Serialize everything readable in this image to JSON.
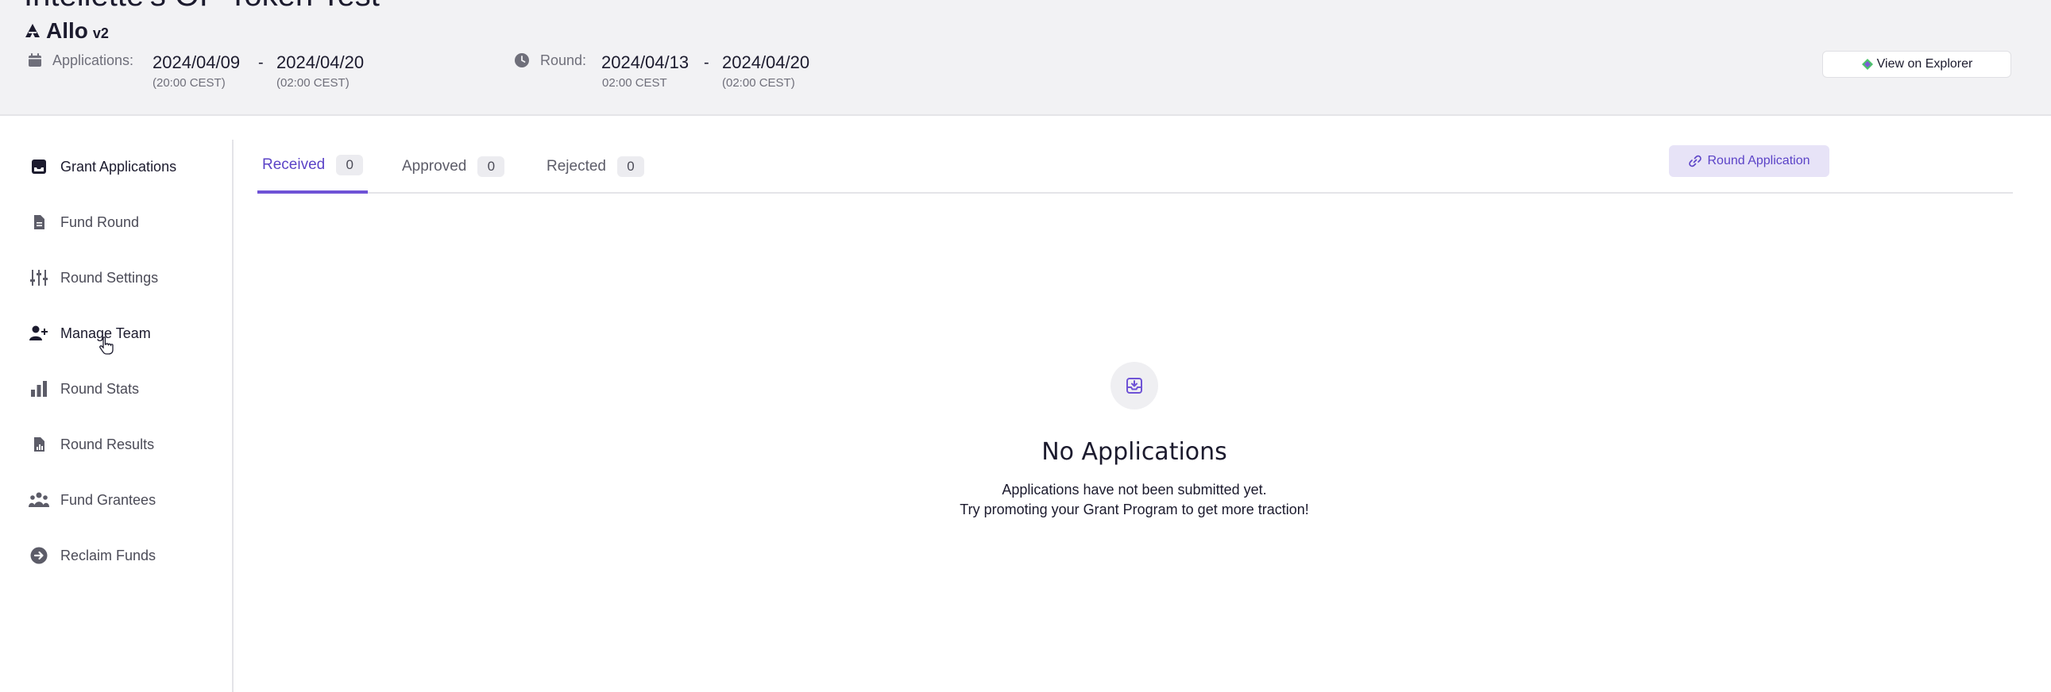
{
  "header": {
    "round_title": "Intellette's OP Token Test",
    "brand": {
      "name": "Allo",
      "version": "v2"
    },
    "applications": {
      "label": "Applications:",
      "start": "2024/04/09",
      "start_sub": "(20:00 CEST)",
      "separator": "-",
      "end": "2024/04/20",
      "end_sub": "(02:00 CEST)"
    },
    "round": {
      "label": "Round:",
      "start": "2024/04/13",
      "start_sub": "02:00 CEST",
      "separator": "-",
      "end": "2024/04/20",
      "end_sub": "(02:00 CEST)"
    },
    "explorer_button": "View on Explorer"
  },
  "sidebar": {
    "items": [
      {
        "label": "Grant Applications",
        "icon": "inbox-icon",
        "active": true
      },
      {
        "label": "Fund Round",
        "icon": "document-icon",
        "active": false
      },
      {
        "label": "Round Settings",
        "icon": "sliders-icon",
        "active": false
      },
      {
        "label": "Manage Team",
        "icon": "user-plus-icon",
        "active": false
      },
      {
        "label": "Round Stats",
        "icon": "bar-chart-icon",
        "active": false
      },
      {
        "label": "Round Results",
        "icon": "document-chart-icon",
        "active": false
      },
      {
        "label": "Fund Grantees",
        "icon": "user-group-icon",
        "active": false
      },
      {
        "label": "Reclaim Funds",
        "icon": "arrow-circle-icon",
        "active": false
      }
    ]
  },
  "tabs": [
    {
      "label": "Received",
      "count": "0",
      "active": true
    },
    {
      "label": "Approved",
      "count": "0",
      "active": false
    },
    {
      "label": "Rejected",
      "count": "0",
      "active": false
    }
  ],
  "round_application_button": "Round Application",
  "empty_state": {
    "title": "No Applications",
    "line1": "Applications have not been submitted yet.",
    "line2": "Try promoting your Grant Program to get more traction!"
  },
  "colors": {
    "accent": "#6f53d6",
    "accent_bg": "#e7e3f7",
    "header_bg": "#f2f2f4"
  }
}
